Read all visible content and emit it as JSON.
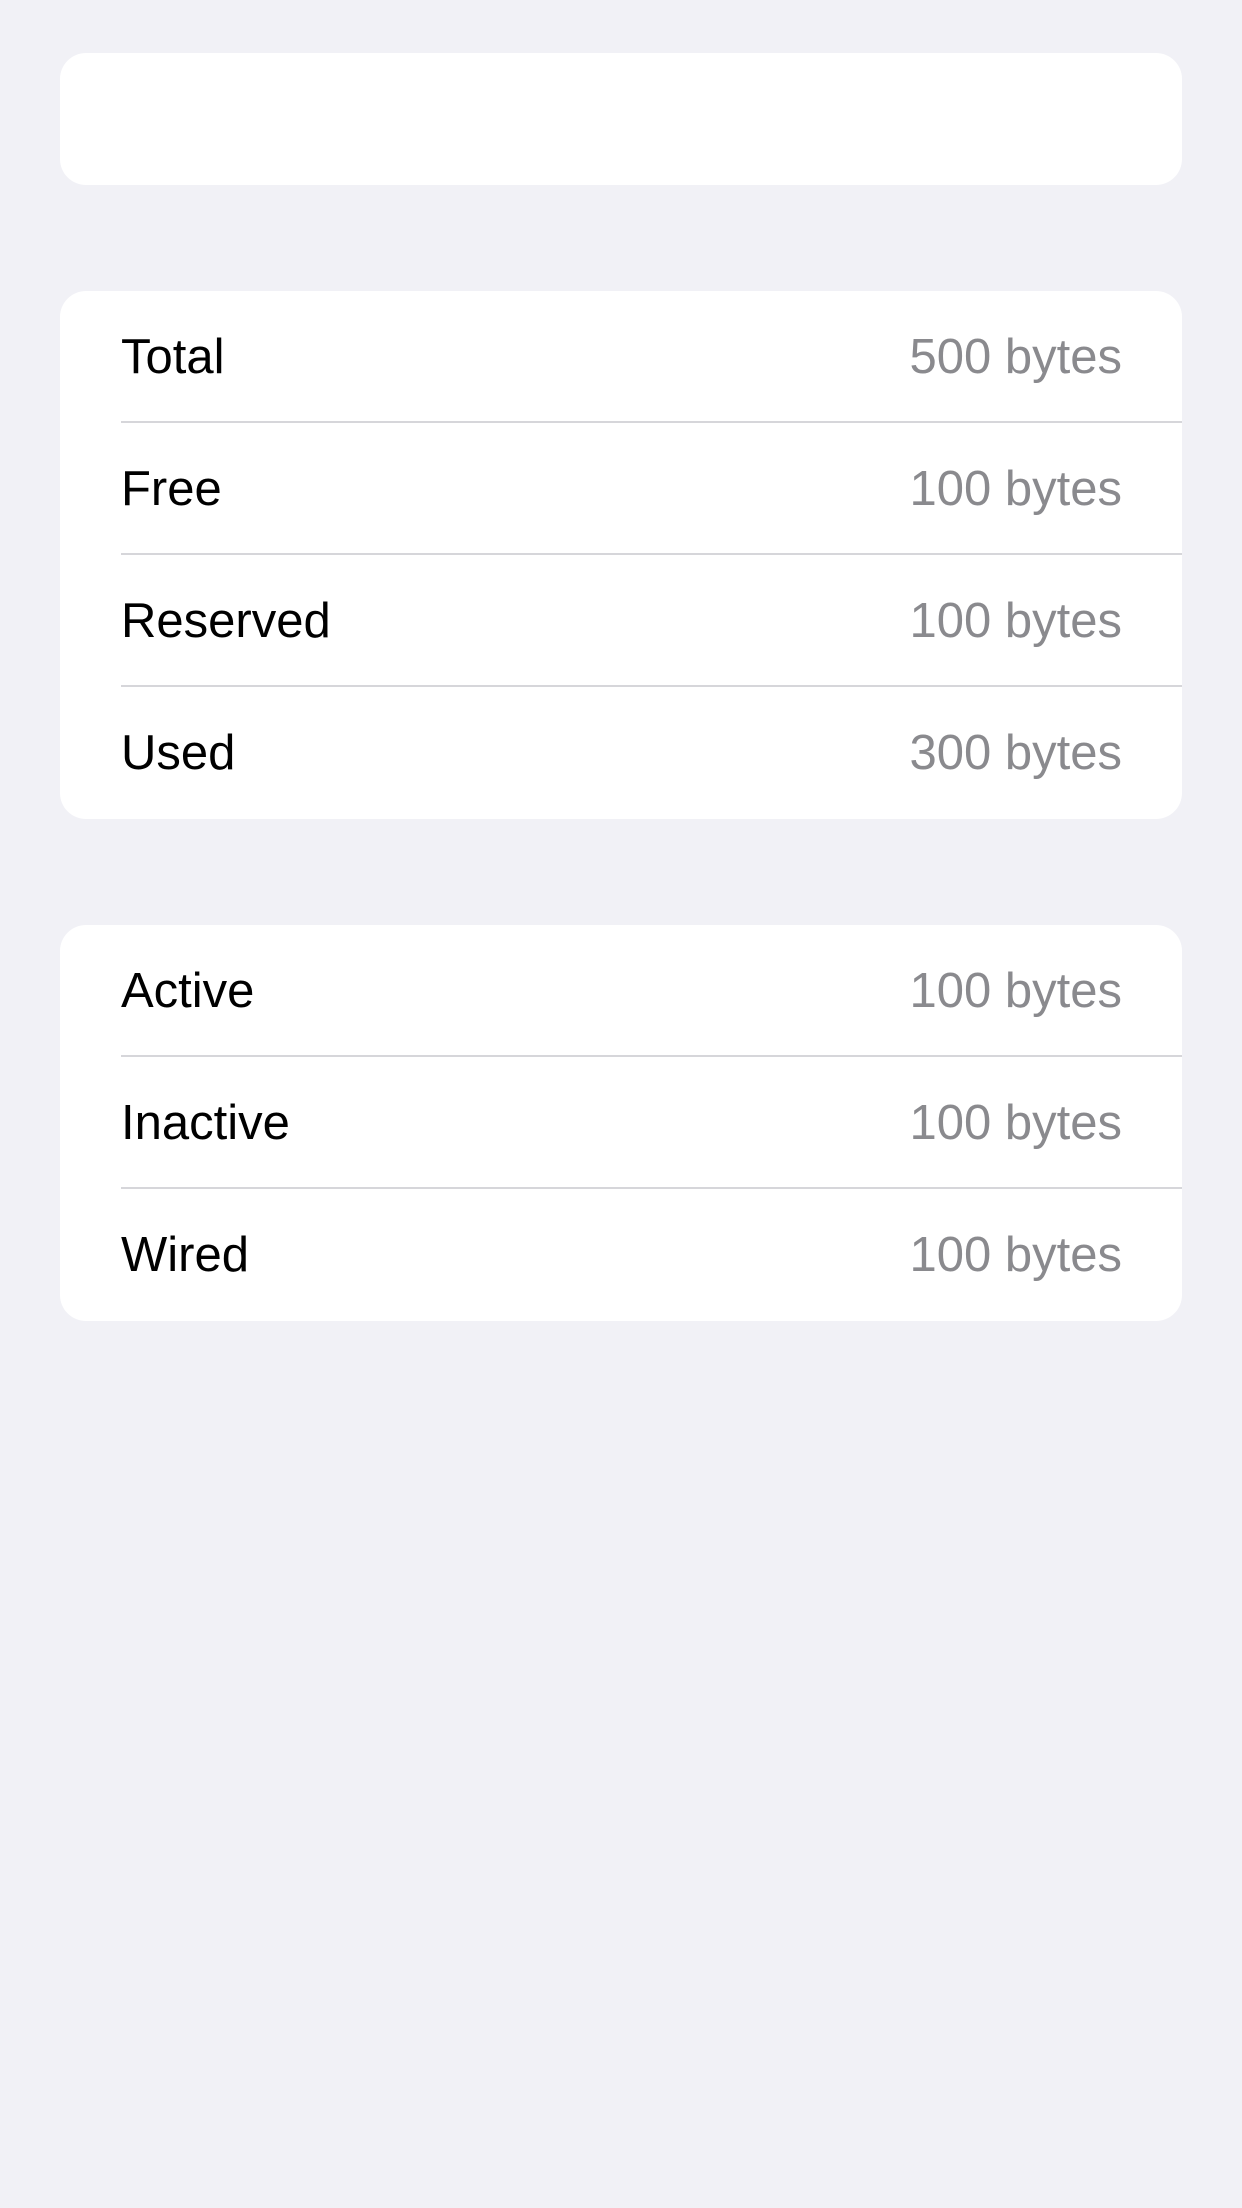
{
  "storage_section": {
    "rows": [
      {
        "label": "Total",
        "value": "500 bytes"
      },
      {
        "label": "Free",
        "value": "100 bytes"
      },
      {
        "label": "Reserved",
        "value": "100 bytes"
      },
      {
        "label": "Used",
        "value": "300 bytes"
      }
    ]
  },
  "memory_section": {
    "rows": [
      {
        "label": "Active",
        "value": "100 bytes"
      },
      {
        "label": "Inactive",
        "value": "100 bytes"
      },
      {
        "label": "Wired",
        "value": "100 bytes"
      }
    ]
  }
}
